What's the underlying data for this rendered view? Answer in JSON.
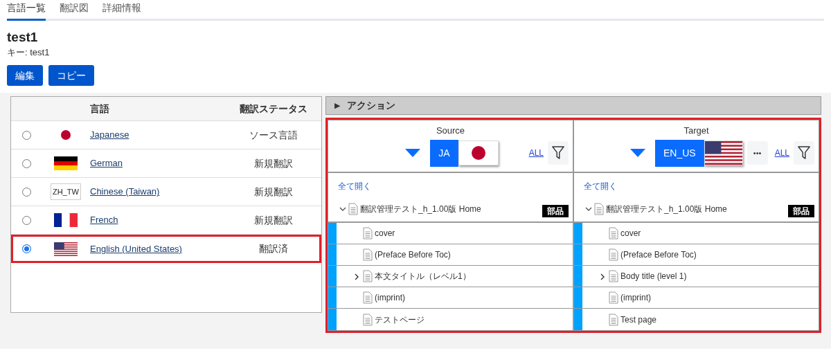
{
  "tabs": [
    {
      "label": "言語一覧",
      "selected": true
    },
    {
      "label": "翻訳図",
      "selected": false
    },
    {
      "label": "詳細情報",
      "selected": false
    }
  ],
  "title": "test1",
  "key_line": "キー: test1",
  "buttons": [
    "編集",
    "コピー"
  ],
  "languages": {
    "columns": [
      "言語",
      "翻訳ステータス"
    ],
    "rows": [
      {
        "flag": {
          "kind": "jp"
        },
        "name": "Japanese",
        "status": "ソース言語",
        "selected": false
      },
      {
        "flag": {
          "kind": "de"
        },
        "name": "German",
        "status": "新規翻訳",
        "selected": false
      },
      {
        "flag": {
          "kind": "text",
          "text": "ZH_TW"
        },
        "name": "Chinese (Taiwan)",
        "status": "新規翻訳",
        "selected": false
      },
      {
        "flag": {
          "kind": "fr"
        },
        "name": "French",
        "status": "新規翻訳",
        "selected": false
      },
      {
        "flag": {
          "kind": "us"
        },
        "name": "English (United States)",
        "status": "翻訳済",
        "selected": true
      }
    ]
  },
  "actions": {
    "toggle": "▶",
    "label": "アクション",
    "expanded": false
  },
  "panes": [
    {
      "heading": "Source",
      "code": "JA",
      "flag": {
        "kind": "jp"
      },
      "all_link": "ALL",
      "expand_all": "全て開く",
      "root": {
        "label": "翻訳管理テスト_h_1.00版 Home",
        "badge": "部品",
        "expanded": true,
        "children": [
          {
            "label": "cover",
            "expandable": false
          },
          {
            "label": "(Preface Before Toc)",
            "expandable": false
          },
          {
            "label": "本文タイトル（レベル1）",
            "expandable": true
          },
          {
            "label": "(imprint)",
            "expandable": false
          },
          {
            "label": "テストページ",
            "expandable": false
          }
        ]
      }
    },
    {
      "heading": "Target",
      "code": "EN_US",
      "flag": {
        "kind": "us"
      },
      "more": "•••",
      "all_link": "ALL",
      "expand_all": "全て開く",
      "root": {
        "label": "翻訳管理テスト_h_1.00版 Home",
        "badge": "部品",
        "expanded": true,
        "children": [
          {
            "label": "cover",
            "expandable": false
          },
          {
            "label": "(Preface Before Toc)",
            "expandable": false
          },
          {
            "label": "Body title (level 1)",
            "expandable": true
          },
          {
            "label": "(imprint)",
            "expandable": false
          },
          {
            "label": "Test page",
            "expandable": false
          }
        ]
      }
    }
  ]
}
